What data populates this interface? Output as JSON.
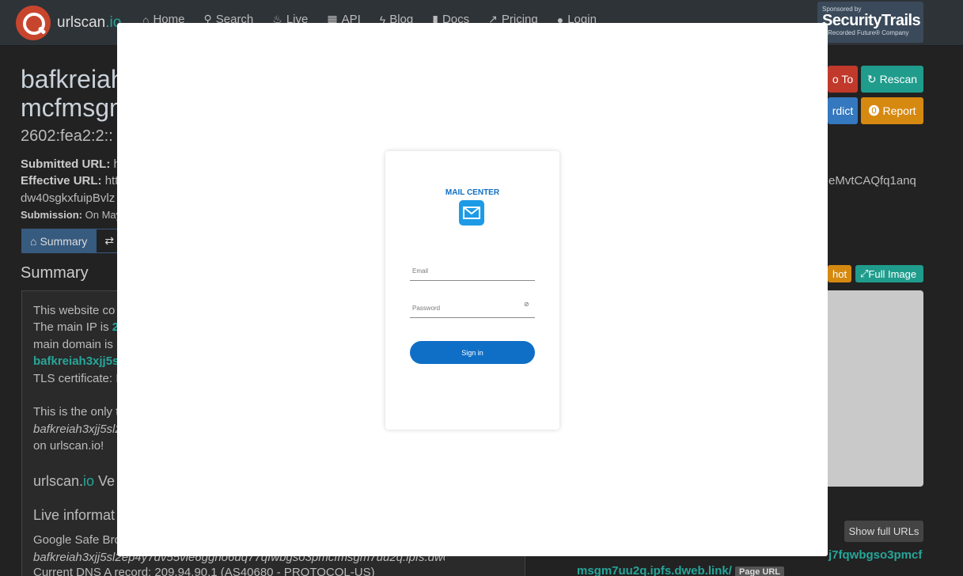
{
  "navbar": {
    "brand_name": "urlscan",
    "brand_tld": ".io",
    "items": [
      {
        "label": "Home",
        "icon": "home-icon"
      },
      {
        "label": "Search",
        "icon": "search-icon"
      },
      {
        "label": "Live",
        "icon": "fire-icon"
      },
      {
        "label": "API",
        "icon": "qr-icon"
      },
      {
        "label": "Blog",
        "icon": "bolt-icon"
      },
      {
        "label": "Docs",
        "icon": "book-icon"
      },
      {
        "label": "Pricing",
        "icon": "external-link-icon"
      },
      {
        "label": "Login",
        "icon": "user-icon"
      }
    ],
    "sponsor": {
      "line1": "Sponsored by",
      "line2": "SecurityTrails",
      "line3": "A Recorded Future® Company"
    }
  },
  "background": {
    "title_line1": "bafkreiah",
    "title_line2": "mcfmsgm",
    "ip": "2602:fea2:2::",
    "submitted_label": "Submitted URL:",
    "submitted_value": "ht",
    "effective_label": "Effective URL:",
    "effective_value": "http",
    "effective_tail": "eMvtCAQfq1anq",
    "effective_line2": "dw40sgkxfuipBvlz",
    "submission_label": "Submission:",
    "submission_value": "On May",
    "tab_summary": "Summary",
    "tab_http": "H",
    "section_title": "Summary",
    "p1_l1": "This website co",
    "p1_l2a": "The main IP is ",
    "p1_l2b": "2",
    "p1_l3": "main domain is",
    "p1_l4": "bafkreiah3xjj5s",
    "p1_l5": "TLS certificate: I",
    "p2_l1": "This is the only t",
    "p2_l2": "bafkreiah3xjj5sl2",
    "p2_l3": "on urlscan.io!",
    "verdict_a": "urlscan.",
    "verdict_b": "io",
    "verdict_c": " Ve",
    "live_info": "Live informat",
    "gsb": "Google Safe Bro",
    "italic_url": "bafkreiah3xjj5sl2ep4y7dv55vie6ggno6uq77qfwbgso3pmcfmsgm7uu2q.ipfs.dweb.link",
    "dns": "Current DNS A record: 209.94.90.1 (AS40680 - PROTOCOL-US)",
    "go_to": "o To",
    "rescan": "Rescan",
    "verdict_btn": "rdict",
    "report": "Report",
    "screenshot_btn": "hot",
    "full_image": "Full Image",
    "show_full_urls": "Show full URLs",
    "right_url1": "j7fqwbgso3pmcf",
    "right_url2": "msgm7uu2q.ipfs.dweb.link/",
    "page_url_badge": "Page URL"
  },
  "modal": {
    "heading": "MAIL CENTER",
    "email_label": "Email",
    "password_label": "Password",
    "sign_in": "Sign in"
  }
}
